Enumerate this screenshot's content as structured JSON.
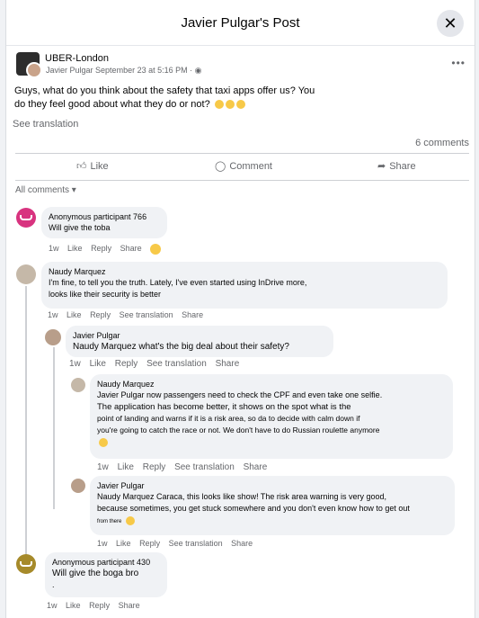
{
  "header": {
    "title": "Javier Pulgar's Post",
    "close_icon": "✕"
  },
  "post": {
    "group": "UBER-London",
    "author": "Javier Pulgar",
    "time": "September 23 at 5:16 PM",
    "text_line1": "Guys, what do you think about the safety that taxi apps offer us? You",
    "text_line2": "do they feel good about what they do or not?",
    "see_translation": "See translation",
    "comments_count": "6 comments"
  },
  "actions": {
    "like": "Like",
    "comment": "Comment",
    "share": "Share"
  },
  "filter": {
    "label": "All comments"
  },
  "comments": [
    {
      "name": "Anonymous participant 766",
      "text": "Will give the toba",
      "time": "1w",
      "like": "Like",
      "reply": "Reply",
      "share": "Share"
    },
    {
      "name": "Naudy Marquez",
      "line1": "I'm fine, to tell you the truth. Lately, I've even started using InDrive more,",
      "line2": "looks like their security is better",
      "time": "1w",
      "like": "Like",
      "reply": "Reply",
      "translate": "See translation",
      "share": "Share"
    },
    {
      "name": "Javier Pulgar",
      "text": "Naudy Marquez what's the big deal about their safety?",
      "time": "1w",
      "like": "Like",
      "reply": "Reply",
      "translate": "See translation",
      "share": "Share"
    },
    {
      "name": "Naudy Marquez",
      "line1": "Javier Pulgar now passengers need to check the CPF and even take one selfie.",
      "line2": "The application has become better, it shows on the spot what is the",
      "line3": "point of landing and warns if it is a risk area, so da to decide with calm down if",
      "line4": "you're going to catch the race or not. We don't have to do Russian roulette anymore",
      "time": "1w",
      "like": "Like",
      "reply": "Reply",
      "translate": "See translation",
      "share": "Share"
    },
    {
      "name": "Javier Pulgar",
      "line1": "Naudy Marquez Caraca, this looks like show! The risk area warning is very good,",
      "line2": "because sometimes, you get stuck somewhere and you don't even know how to get out",
      "line3": "from there",
      "time": "1w",
      "like": "Like",
      "reply": "Reply",
      "translate": "See translation",
      "share": "Share"
    },
    {
      "name": "Anonymous participant 430",
      "line1": "Will give the boga bro",
      "line2": ".",
      "time": "1w",
      "like": "Like",
      "reply": "Reply",
      "share": "Share"
    }
  ],
  "colors": {
    "anon_pink": "#d8337f",
    "anon_gold": "#a68a2a",
    "text_secondary": "#65676b"
  }
}
